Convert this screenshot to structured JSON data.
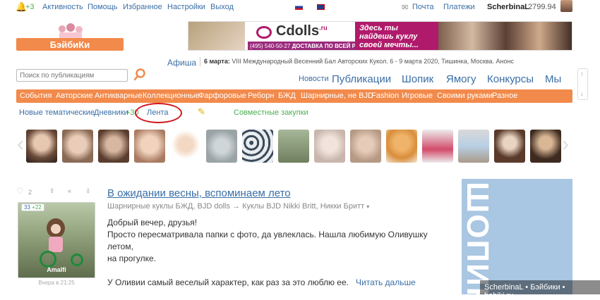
{
  "topbar": {
    "notif_count": "+3",
    "links": [
      "Активность",
      "Помощь",
      "Избранное",
      "Настройки",
      "Выход"
    ],
    "mail": "Почта",
    "payments": "Платежи",
    "username": "ScherbinaL",
    "balance": "2799.94"
  },
  "logo": {
    "text": "БэйбиКи"
  },
  "banner": {
    "brand": "Cdolls",
    "brand_suffix": ".ru",
    "phone": "(495) 540-50-27",
    "delivery": "ДОСТАВКА ПО ВСЕЙ РОССИИ",
    "slogan_line1": "Здесь ты",
    "slogan_line2": "найдешь куклу",
    "slogan_line3": "своей мечты..."
  },
  "afisha": {
    "label": "Афиша",
    "date": "6 марта:",
    "event": "VIII Международный Весенний Бал Авторских Кукол. 6 - 9 марта 2020, Тишинка, Москва. Анонс"
  },
  "search": {
    "placeholder": "Поиск по публикациям"
  },
  "main_nav": {
    "news": "Новости",
    "items": [
      "Публикации",
      "Шопик",
      "Ямогу",
      "Конкурсы",
      "Мы"
    ]
  },
  "categories": [
    "События",
    "Авторские",
    "Антикварные",
    "Коллекционные",
    "Фарфоровые",
    "Реборн",
    "БЖД",
    "Шарнирные, не BJD",
    "Fashion",
    "Игровые",
    "Своими руками",
    "Разное"
  ],
  "subnav": {
    "new_thematic": "Новые тематические",
    "diaries": "Дневники",
    "diaries_count": "+30",
    "feed": "Лента",
    "joint": "Совместные закупки"
  },
  "post": {
    "likes": "2",
    "title": "В ожидании весны, вспоминаем лето",
    "category": "Шарнирные куклы БЖД, BJD dolls",
    "subcategory": "→ Куклы BJD Nikki Britt, Никки Бритт",
    "photo_count": "33",
    "photo_plus": "+22",
    "doll_name": "Amalfi",
    "time": "Вчера в 21:25",
    "lines": [
      "Добрый вечер, друзья!",
      "Просто пересматривала папки с фото, да увлеклась. Нашла любимую Оливушку летом,",
      "на прогулке.",
      "",
      "У Оливии самый веселый характер, как раз за это люблю ее."
    ],
    "read_more": "Читать дальше"
  },
  "ad": {
    "text": "ШОПИК"
  },
  "watermark": "ScherbinaL • Бэйбики • babiki.ru",
  "colors": {
    "accent": "#f28a4b",
    "link": "#3a6ea5",
    "annotation": "#d0171c"
  }
}
